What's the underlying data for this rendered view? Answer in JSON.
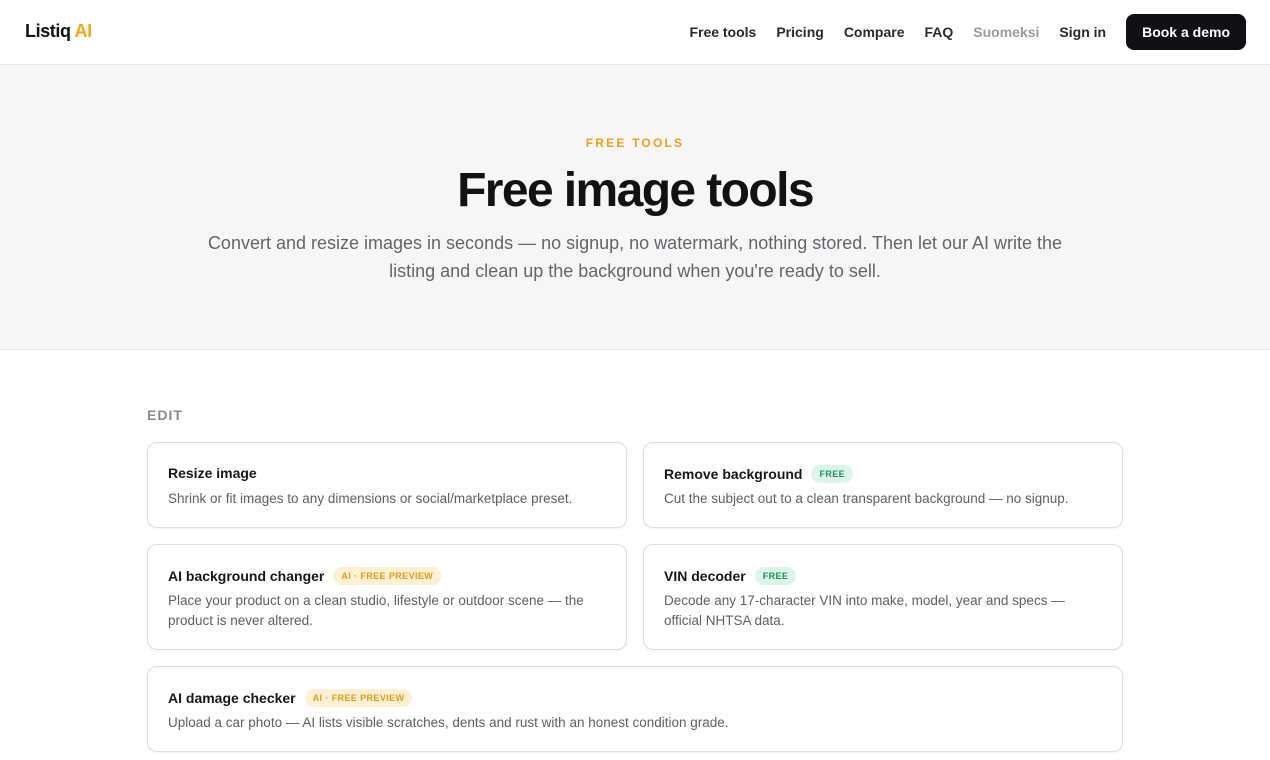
{
  "header": {
    "brand_main": "Listiq",
    "brand_accent": "AI",
    "nav": [
      "Free tools",
      "Pricing",
      "Compare",
      "FAQ",
      "Suomeksi",
      "Sign in"
    ],
    "cta": "Book a demo"
  },
  "hero": {
    "eyebrow": "FREE TOOLS",
    "title": "Free image tools",
    "subtitle": "Convert and resize images in seconds — no signup, no watermark, nothing stored. Then let our AI write the listing and clean up the background when you're ready to sell."
  },
  "section": {
    "label": "EDIT",
    "cards": [
      {
        "title": "Resize image",
        "badge": "",
        "desc": "Shrink or fit images to any dimensions or social/marketplace preset."
      },
      {
        "title": "Remove background",
        "badge": "FREE",
        "desc": "Cut the subject out to a clean transparent background — no signup."
      },
      {
        "title": "AI background changer",
        "badge": "AI · FREE PREVIEW",
        "desc": "Place your product on a clean studio, lifestyle or outdoor scene — the product is never altered."
      },
      {
        "title": "VIN decoder",
        "badge": "FREE",
        "desc": "Decode any 17-character VIN into make, model, year and specs — official NHTSA data."
      },
      {
        "title": "AI damage checker",
        "badge": "AI · FREE PREVIEW",
        "desc": "Upload a car photo — AI lists visible scratches, dents and rust with an honest condition grade."
      }
    ]
  },
  "colors": {
    "accent": "#f2a61b",
    "hero_bg": "#f6f6f7",
    "cta_bg": "#111113",
    "badge_free_bg": "#dcf5e8",
    "badge_free_text": "#17955a",
    "badge_preview_bg": "#fdf0d3",
    "badge_preview_text": "#e39b17"
  }
}
